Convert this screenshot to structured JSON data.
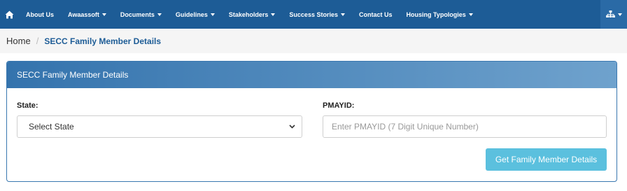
{
  "nav": {
    "items": [
      {
        "label": "About Us",
        "dropdown": false
      },
      {
        "label": "Awaassoft",
        "dropdown": true
      },
      {
        "label": "Documents",
        "dropdown": true
      },
      {
        "label": "Guidelines",
        "dropdown": true
      },
      {
        "label": "Stakeholders",
        "dropdown": true
      },
      {
        "label": "Success Stories",
        "dropdown": true
      },
      {
        "label": "Contact Us",
        "dropdown": false
      },
      {
        "label": "Housing Typologies",
        "dropdown": true
      }
    ],
    "home_icon": "home-icon",
    "right_icon": "sitemap-icon",
    "color": "#1d5c96"
  },
  "breadcrumb": {
    "home": "Home",
    "separator": "/",
    "current": "SECC Family Member Details"
  },
  "panel": {
    "title": "SECC Family Member Details",
    "state_label": "State:",
    "state_value": "Select State",
    "pmayid_label": "PMAYID:",
    "pmayid_placeholder": "Enter PMAYID (7 Digit Unique Number)",
    "submit_label": "Get Family Member Details",
    "button_color": "#5bc0de"
  }
}
